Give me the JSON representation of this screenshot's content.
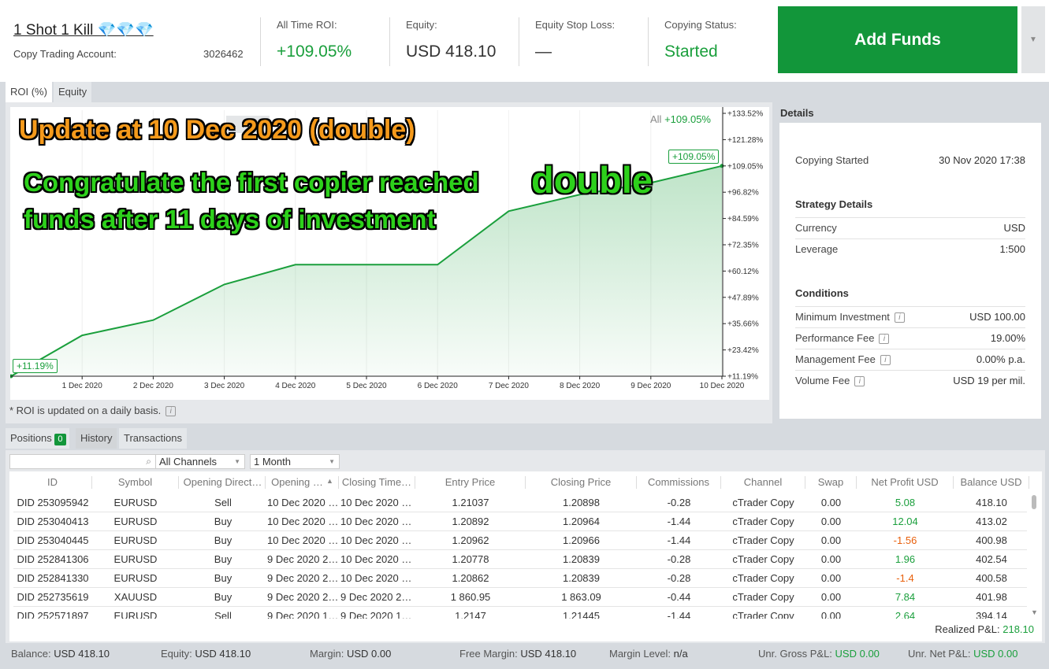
{
  "header": {
    "strategy_name": "1 Shot 1 Kill 💎💎💎",
    "account_label": "Copy Trading Account:",
    "account_number": "3026462",
    "roi_label": "All Time ROI:",
    "roi_value": "+109.05%",
    "equity_label": "Equity:",
    "equity_value": "USD 418.10",
    "stoploss_label": "Equity Stop Loss:",
    "stoploss_value": "—",
    "status_label": "Copying Status:",
    "status_value": "Started",
    "add_funds": "Add Funds"
  },
  "chart_tabs": [
    "ROI (%)",
    "Equity"
  ],
  "chart_data": {
    "type": "area",
    "x": [
      "30 Nov 2020",
      "1 Dec 2020",
      "2 Dec 2020",
      "3 Dec 2020",
      "4 Dec 2020",
      "5 Dec 2020",
      "6 Dec 2020",
      "7 Dec 2020",
      "8 Dec 2020",
      "9 Dec 2020",
      "10 Dec 2020"
    ],
    "values": [
      11.19,
      30.2,
      37.3,
      53.9,
      63.1,
      63.1,
      63.1,
      88.0,
      95.7,
      101.2,
      109.05
    ],
    "xticks": [
      "1 Dec 2020",
      "2 Dec 2020",
      "3 Dec 2020",
      "4 Dec 2020",
      "5 Dec 2020",
      "6 Dec 2020",
      "7 Dec 2020",
      "8 Dec 2020",
      "9 Dec 2020",
      "10 Dec 2020"
    ],
    "yticks": [
      "+133.52%",
      "+121.28%",
      "+109.05%",
      "+96.82%",
      "+84.59%",
      "+72.35%",
      "+60.12%",
      "+47.89%",
      "+35.66%",
      "+23.42%",
      "+11.19%"
    ],
    "ylim": [
      11.19,
      133.52
    ],
    "start_label": "+11.19%",
    "end_label": "+109.05%",
    "legend_prefix": "All",
    "legend_value": "+109.05%",
    "range_button": "All",
    "color": "#1a9f3c"
  },
  "chart_note": "* ROI is updated on a daily basis.",
  "overlay": {
    "line1": "Update at 10 Dec 2020 (double)",
    "line2a": "Congratulate the first copier reached",
    "line2b": "double",
    "line3": "funds after 11 days of investment"
  },
  "details": {
    "title": "Details",
    "copying_started_label": "Copying Started",
    "copying_started_value": "30 Nov 2020 17:38",
    "strategy_title": "Strategy Details",
    "currency_label": "Currency",
    "currency_value": "USD",
    "leverage_label": "Leverage",
    "leverage_value": "1:500",
    "conditions_title": "Conditions",
    "min_inv_label": "Minimum Investment",
    "min_inv_value": "USD 100.00",
    "perf_fee_label": "Performance Fee",
    "perf_fee_value": "19.00%",
    "mgmt_fee_label": "Management Fee",
    "mgmt_fee_value": "0.00% p.a.",
    "vol_fee_label": "Volume Fee",
    "vol_fee_value": "USD 19 per mil."
  },
  "bottom_tabs": {
    "positions": "Positions",
    "positions_count": "0",
    "history": "History",
    "transactions": "Transactions"
  },
  "filters": {
    "search_placeholder": "",
    "channels": "All Channels",
    "period": "1 Month"
  },
  "table": {
    "columns": [
      "ID",
      "Symbol",
      "Opening Direct…",
      "Opening …",
      "Closing Time…",
      "Entry Price",
      "Closing Price",
      "Commissions",
      "Channel",
      "Swap",
      "Net Profit USD",
      "Balance USD"
    ],
    "rows": [
      [
        "DID 253095942",
        "EURUSD",
        "Sell",
        "10 Dec 2020 …",
        "10 Dec 2020 …",
        "1.21037",
        "1.20898",
        "-0.28",
        "cTrader Copy",
        "0.00",
        "5.08",
        "418.10"
      ],
      [
        "DID 253040413",
        "EURUSD",
        "Buy",
        "10 Dec 2020 …",
        "10 Dec 2020 …",
        "1.20892",
        "1.20964",
        "-1.44",
        "cTrader Copy",
        "0.00",
        "12.04",
        "413.02"
      ],
      [
        "DID 253040445",
        "EURUSD",
        "Buy",
        "10 Dec 2020 …",
        "10 Dec 2020 …",
        "1.20962",
        "1.20966",
        "-1.44",
        "cTrader Copy",
        "0.00",
        "-1.56",
        "400.98"
      ],
      [
        "DID 252841306",
        "EURUSD",
        "Buy",
        "9 Dec 2020 2…",
        "10 Dec 2020 …",
        "1.20778",
        "1.20839",
        "-0.28",
        "cTrader Copy",
        "0.00",
        "1.96",
        "402.54"
      ],
      [
        "DID 252841330",
        "EURUSD",
        "Buy",
        "9 Dec 2020 2…",
        "10 Dec 2020 …",
        "1.20862",
        "1.20839",
        "-0.28",
        "cTrader Copy",
        "0.00",
        "-1.4",
        "400.58"
      ],
      [
        "DID 252735619",
        "XAUUSD",
        "Buy",
        "9 Dec 2020 2…",
        "9 Dec 2020 2…",
        "1 860.95",
        "1 863.09",
        "-0.44",
        "cTrader Copy",
        "0.00",
        "7.84",
        "401.98"
      ],
      [
        "DID 252571897",
        "EURUSD",
        "Sell",
        "9 Dec 2020 1…",
        "9 Dec 2020 1…",
        "1.2147",
        "1.21445",
        "-1.44",
        "cTrader Copy",
        "0.00",
        "2.64",
        "394.14"
      ]
    ],
    "realized_label": "Realized P&L:",
    "realized_value": "218.10"
  },
  "statusbar": {
    "balance_label": "Balance:",
    "balance_value": "USD 418.10",
    "equity_label": "Equity:",
    "equity_value": "USD 418.10",
    "margin_label": "Margin:",
    "margin_value": "USD 0.00",
    "free_margin_label": "Free Margin:",
    "free_margin_value": "USD 418.10",
    "margin_level_label": "Margin Level:",
    "margin_level_value": "n/a",
    "unr_gross_label": "Unr. Gross P&L:",
    "unr_gross_value": "USD 0.00",
    "unr_net_label": "Unr. Net P&L:",
    "unr_net_value": "USD 0.00"
  }
}
